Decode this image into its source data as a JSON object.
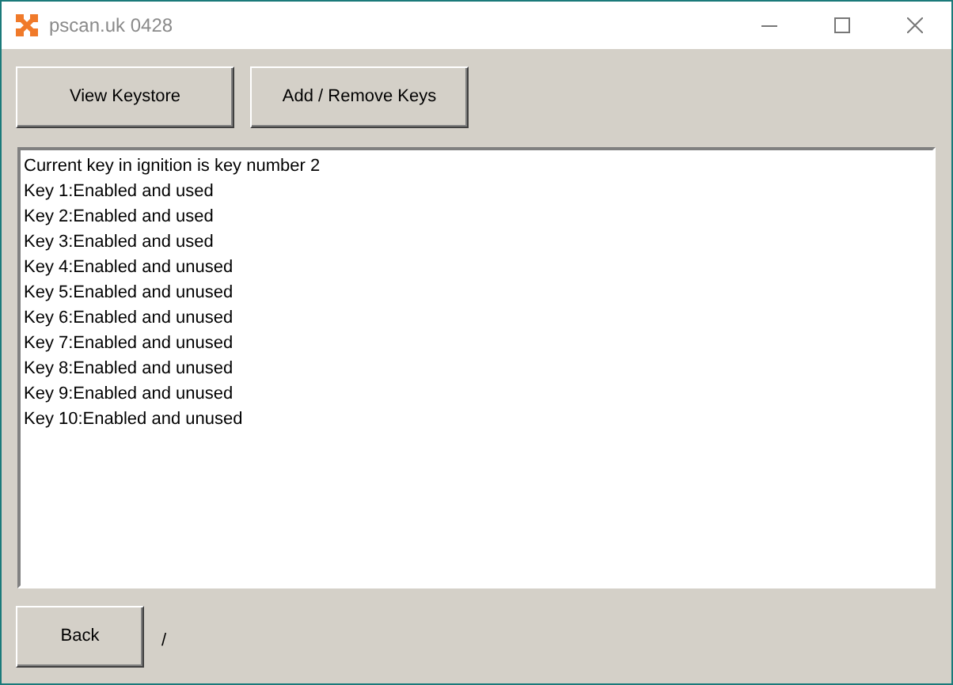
{
  "window": {
    "title": "pscan.uk 0428"
  },
  "top_buttons": [
    "View Keystore",
    "Add / Remove Keys"
  ],
  "output_lines": [
    "Current key in ignition is key number 2",
    "Key 1:Enabled and used",
    "Key 2:Enabled and used",
    "Key 3:Enabled and used",
    "Key 4:Enabled and unused",
    "Key 5:Enabled and unused",
    "Key 6:Enabled and unused",
    "Key 7:Enabled and unused",
    "Key 8:Enabled and unused",
    "Key 9:Enabled and unused",
    "Key 10:Enabled and unused"
  ],
  "back_button": "Back",
  "status_text": "/"
}
